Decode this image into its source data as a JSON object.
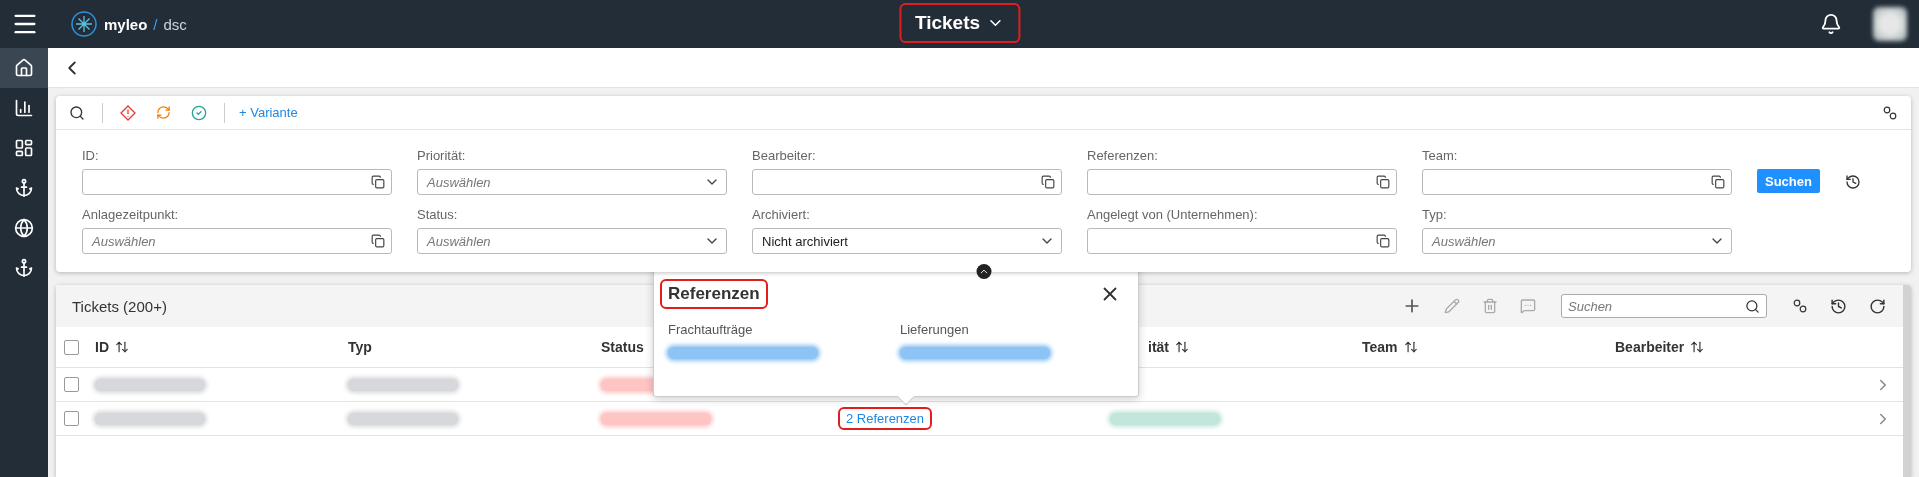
{
  "topbar": {
    "brand": "myleo",
    "separator": "/",
    "product": "dsc",
    "title": "Tickets",
    "title_highlighted": true
  },
  "sidebar": {
    "items": [
      {
        "selected": true
      },
      {
        "selected": false
      },
      {
        "selected": false
      },
      {
        "selected": false
      },
      {
        "selected": false
      },
      {
        "selected": false
      }
    ]
  },
  "filter": {
    "variant_link": "+ Variante",
    "fields": [
      {
        "label": "ID:",
        "kind": "text"
      },
      {
        "label": "Priorität:",
        "kind": "select",
        "placeholder": "Auswählen"
      },
      {
        "label": "Bearbeiter:",
        "kind": "text"
      },
      {
        "label": "Referenzen:",
        "kind": "text"
      },
      {
        "label": "Team:",
        "kind": "text"
      },
      {
        "label": "Anlagezeitpunkt:",
        "kind": "text",
        "placeholder": "Auswählen"
      },
      {
        "label": "Status:",
        "kind": "select",
        "placeholder": "Auswählen"
      },
      {
        "label": "Archiviert:",
        "kind": "select",
        "value": "Nicht archiviert"
      },
      {
        "label": "Angelegt von (Unternehmen):",
        "kind": "text"
      },
      {
        "label": "Typ:",
        "kind": "select",
        "placeholder": "Auswählen"
      }
    ],
    "search_button": "Suchen"
  },
  "table": {
    "title": "Tickets (200+)",
    "search_placeholder": "Suchen",
    "select_all_checked": false,
    "columns": [
      {
        "label": "ID",
        "sortable": true
      },
      {
        "label": "Typ",
        "sortable": false
      },
      {
        "label": "Status",
        "sortable": false
      },
      {
        "label": "ität",
        "sortable": true
      },
      {
        "label": "Team",
        "sortable": true
      },
      {
        "label": "Bearbeiter",
        "sortable": true
      }
    ],
    "rows": [
      {
        "checked": false,
        "cells": [
          {
            "kind": "blurred",
            "color": "#d6d8db"
          },
          {
            "kind": "blurred",
            "color": "#d6d8db"
          },
          {
            "kind": "blurred",
            "color": "#ffc4c4"
          },
          {
            "kind": "empty"
          },
          {
            "kind": "empty"
          },
          {
            "kind": "empty"
          },
          {
            "kind": "empty"
          }
        ]
      },
      {
        "checked": false,
        "cells": [
          {
            "kind": "blurred",
            "color": "#d6d8db"
          },
          {
            "kind": "blurred",
            "color": "#d6d8db"
          },
          {
            "kind": "blurred",
            "color": "#ffc4c4"
          },
          {
            "kind": "link",
            "text": "2 Referenzen",
            "highlighted": true
          },
          {
            "kind": "blurred",
            "color": "#c2e6dc"
          },
          {
            "kind": "empty"
          },
          {
            "kind": "empty"
          }
        ]
      }
    ]
  },
  "popover": {
    "title": "Referenzen",
    "title_highlighted": true,
    "sections": [
      {
        "label": "Frachtaufträge"
      },
      {
        "label": "Lieferungen"
      }
    ]
  }
}
